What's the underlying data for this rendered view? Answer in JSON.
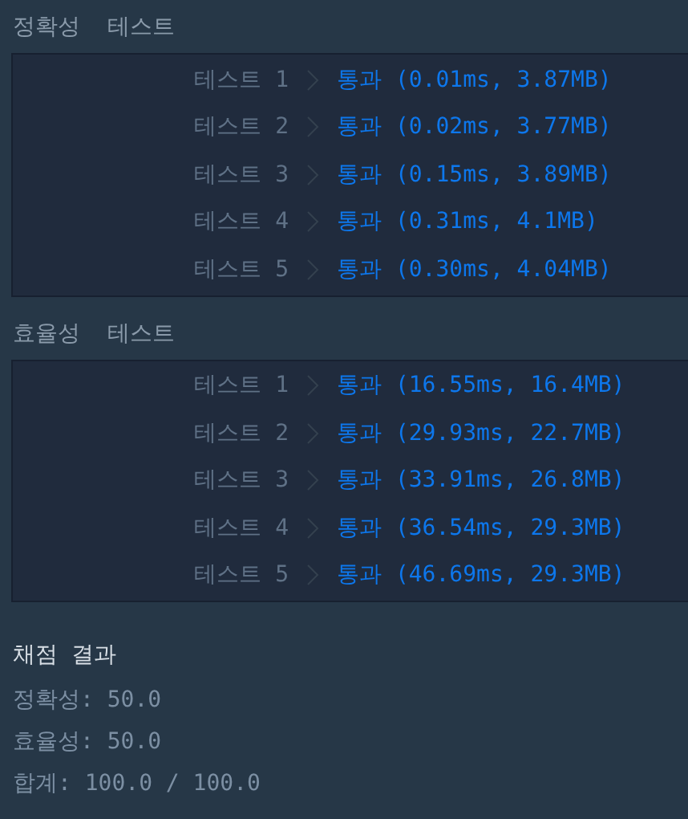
{
  "sections": [
    {
      "title": "정확성  테스트",
      "rows": [
        {
          "label": "테스트 1",
          "status": "통과",
          "result": "(0.01ms, 3.87MB)"
        },
        {
          "label": "테스트 2",
          "status": "통과",
          "result": "(0.02ms, 3.77MB)"
        },
        {
          "label": "테스트 3",
          "status": "통과",
          "result": "(0.15ms, 3.89MB)"
        },
        {
          "label": "테스트 4",
          "status": "통과",
          "result": "(0.31ms, 4.1MB)"
        },
        {
          "label": "테스트 5",
          "status": "통과",
          "result": "(0.30ms, 4.04MB)"
        }
      ]
    },
    {
      "title": "효율성  테스트",
      "rows": [
        {
          "label": "테스트 1",
          "status": "통과",
          "result": "(16.55ms, 16.4MB)"
        },
        {
          "label": "테스트 2",
          "status": "통과",
          "result": "(29.93ms, 22.7MB)"
        },
        {
          "label": "테스트 3",
          "status": "통과",
          "result": "(33.91ms, 26.8MB)"
        },
        {
          "label": "테스트 4",
          "status": "통과",
          "result": "(36.54ms, 29.3MB)"
        },
        {
          "label": "테스트 5",
          "status": "통과",
          "result": "(46.69ms, 29.3MB)"
        }
      ]
    }
  ],
  "summary": {
    "title": "채점 결과",
    "lines": [
      "정확성: 50.0",
      "효율성: 50.0",
      "합계: 100.0 / 100.0"
    ]
  }
}
